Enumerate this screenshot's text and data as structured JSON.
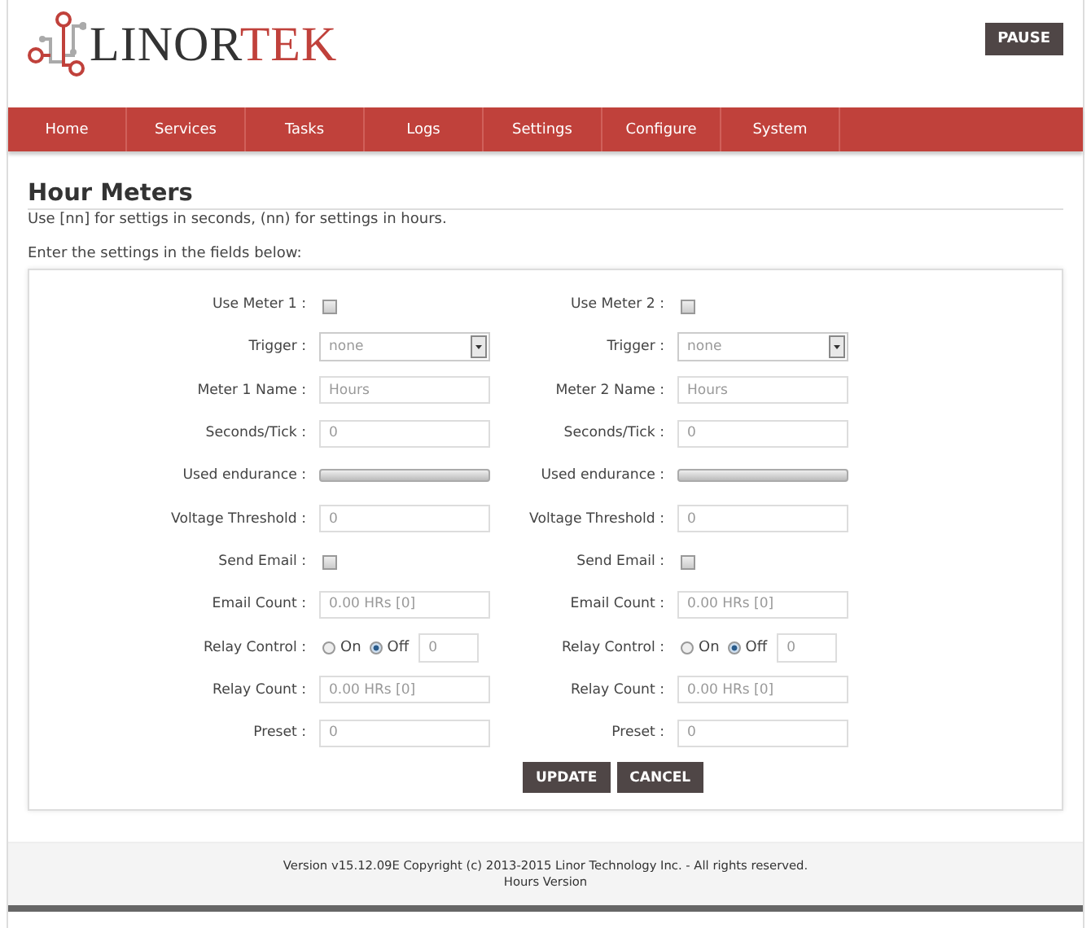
{
  "header": {
    "logo": {
      "dark": "LINOR",
      "accent": "TEK"
    },
    "pause_button": "PAUSE"
  },
  "nav": [
    "Home",
    "Services",
    "Tasks",
    "Logs",
    "Settings",
    "Configure",
    "System"
  ],
  "page": {
    "title": "Hour Meters",
    "note": "Use [nn] for settigs in seconds, (nn) for settings in hours.",
    "instruction": "Enter the settings in the fields below:"
  },
  "meters": [
    {
      "rows": [
        {
          "kind": "checkbox",
          "label": "Use Meter 1 :",
          "checked": false
        },
        {
          "kind": "select",
          "label": "Trigger :",
          "value": "none"
        },
        {
          "kind": "text",
          "label": "Meter 1 Name :",
          "value": "Hours"
        },
        {
          "kind": "text",
          "label": "Seconds/Tick :",
          "value": "0"
        },
        {
          "kind": "bar",
          "label": "Used endurance :",
          "level": 0
        },
        {
          "kind": "text",
          "label": "Voltage Threshold :",
          "value": "0"
        },
        {
          "kind": "checkbox",
          "label": "Send Email :",
          "checked": false
        },
        {
          "kind": "text",
          "label": "Email Count :",
          "value": "0.00 HRs [0]"
        },
        {
          "kind": "radio",
          "label": "Relay Control :",
          "options": [
            {
              "label": "On",
              "selected": false
            },
            {
              "label": "Off",
              "selected": true
            }
          ],
          "value": "0"
        },
        {
          "kind": "text",
          "label": "Relay Count :",
          "value": "0.00 HRs [0]"
        },
        {
          "kind": "text",
          "label": "Preset :",
          "value": "0"
        }
      ]
    },
    {
      "rows": [
        {
          "kind": "checkbox",
          "label": "Use Meter 2 :",
          "checked": false
        },
        {
          "kind": "select",
          "label": "Trigger :",
          "value": "none"
        },
        {
          "kind": "text",
          "label": "Meter 2 Name :",
          "value": "Hours"
        },
        {
          "kind": "text",
          "label": "Seconds/Tick :",
          "value": "0"
        },
        {
          "kind": "bar",
          "label": "Used endurance :",
          "level": 0
        },
        {
          "kind": "text",
          "label": "Voltage Threshold :",
          "value": "0"
        },
        {
          "kind": "checkbox",
          "label": "Send Email :",
          "checked": false
        },
        {
          "kind": "text",
          "label": "Email Count :",
          "value": "0.00 HRs [0]"
        },
        {
          "kind": "radio",
          "label": "Relay Control :",
          "options": [
            {
              "label": "On",
              "selected": false
            },
            {
              "label": "Off",
              "selected": true
            }
          ],
          "value": "0"
        },
        {
          "kind": "text",
          "label": "Relay Count :",
          "value": "0.00 HRs [0]"
        },
        {
          "kind": "text",
          "label": "Preset :",
          "value": "0"
        }
      ]
    }
  ],
  "buttons": [
    "UPDATE",
    "CANCEL"
  ],
  "footer": {
    "copyright": "Version v15.12.09E Copyright (c) 2013-2015 Linor Technology Inc. - All rights reserved.",
    "edition": "Hours Version"
  }
}
